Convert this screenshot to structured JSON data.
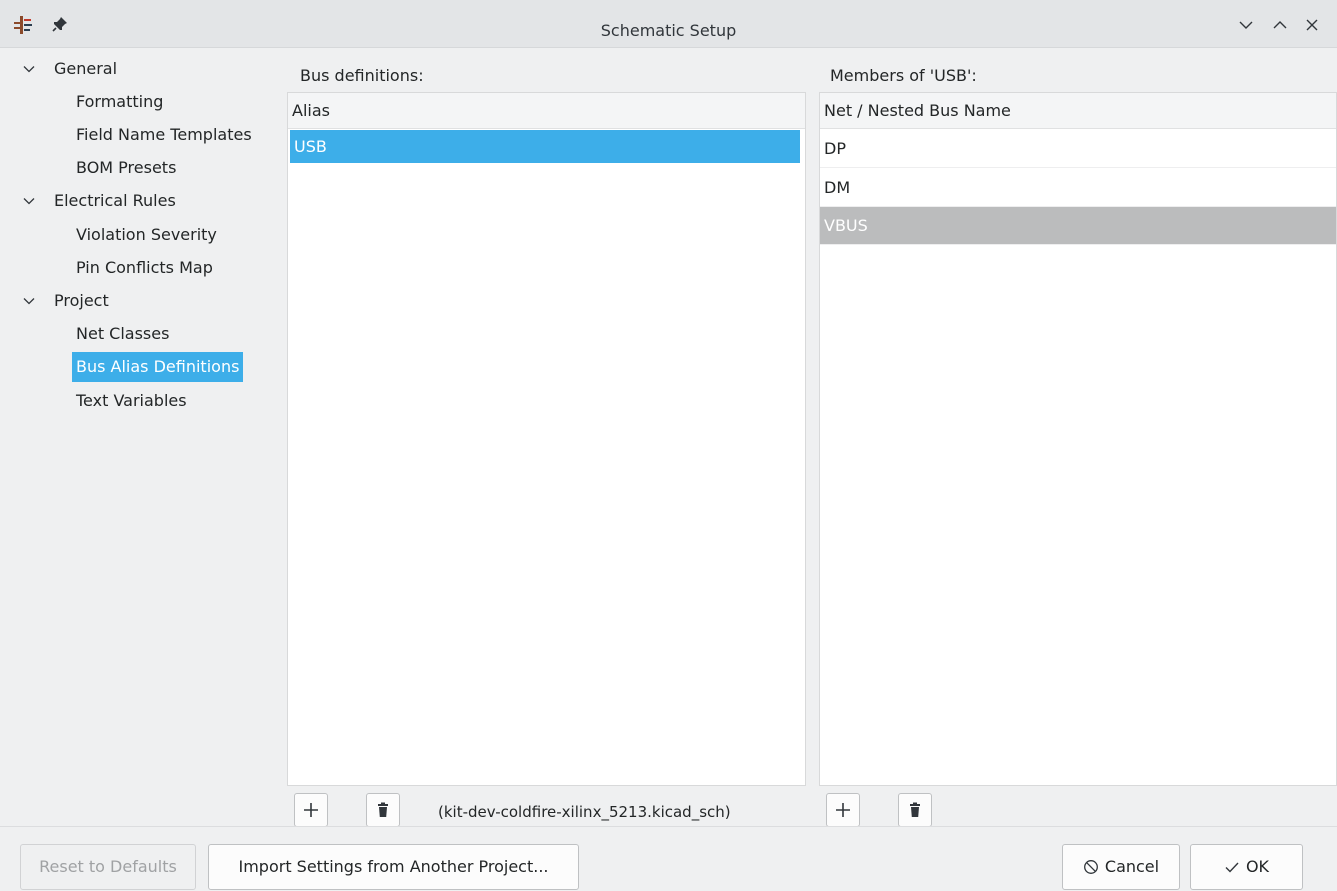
{
  "window": {
    "title": "Schematic Setup"
  },
  "sidebar": {
    "items": [
      {
        "label": "General",
        "expanded": true,
        "level": 0
      },
      {
        "label": "Formatting",
        "level": 1
      },
      {
        "label": "Field Name Templates",
        "level": 1
      },
      {
        "label": "BOM Presets",
        "level": 1
      },
      {
        "label": "Electrical Rules",
        "expanded": true,
        "level": 0
      },
      {
        "label": "Violation Severity",
        "level": 1
      },
      {
        "label": "Pin Conflicts Map",
        "level": 1
      },
      {
        "label": "Project",
        "expanded": true,
        "level": 0
      },
      {
        "label": "Net Classes",
        "level": 1
      },
      {
        "label": "Bus Alias Definitions",
        "level": 1,
        "selected": true
      },
      {
        "label": "Text Variables",
        "level": 1
      }
    ]
  },
  "bus_definitions": {
    "label": "Bus definitions:",
    "column_header": "Alias",
    "rows": [
      "USB"
    ],
    "selected_row": "USB",
    "file_name": "(kit-dev-coldfire-xilinx_5213.kicad_sch)"
  },
  "members": {
    "label": "Members of 'USB':",
    "column_header": "Net / Nested Bus Name",
    "rows": [
      "DP",
      "DM",
      "VBUS"
    ],
    "selected_row": "VBUS"
  },
  "footer": {
    "reset_label": "Reset to Defaults",
    "import_label": "Import Settings from Another Project...",
    "cancel_label": "Cancel",
    "ok_label": "OK"
  },
  "colors": {
    "accent": "#3daee9",
    "inactive_selection": "#bbbcbd",
    "window_bg": "#eff0f1"
  }
}
